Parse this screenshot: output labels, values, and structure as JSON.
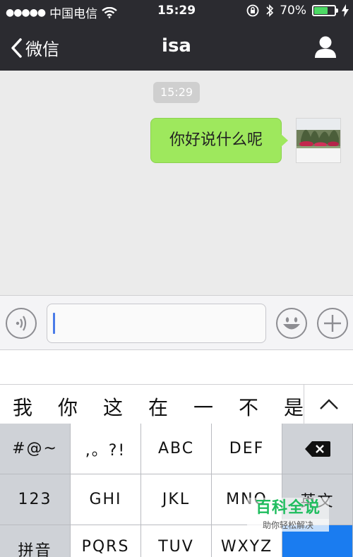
{
  "status_bar": {
    "carrier": "中国电信",
    "time": "15:29",
    "battery": "70%",
    "battery_level": 0.7
  },
  "nav": {
    "back_label": "微信",
    "title": "isa"
  },
  "chat": {
    "timestamp": "15:29",
    "messages": [
      {
        "sender": "self",
        "text": "你好说什么呢"
      }
    ]
  },
  "candidates": [
    "我",
    "你",
    "这",
    "在",
    "一",
    "不",
    "是"
  ],
  "keyboard": {
    "symbols": "#@~",
    "punct": ",。?!",
    "abc": "ABC",
    "def": "DEF",
    "num": "123",
    "ghi": "GHI",
    "jkl": "JKL",
    "mno": "MNO",
    "english": "英文",
    "pinyin": "拼音",
    "pqrs": "PQRS",
    "tuv": "TUV",
    "wxyz": "WXYZ"
  },
  "watermark": {
    "title": "百科全说",
    "subtitle": "助你轻松解决"
  },
  "colors": {
    "nav_bg": "#2b2b30",
    "bubble_self": "#9ee85d",
    "battery_fill": "#4cd964",
    "accent_blue": "#1a7cf0"
  }
}
